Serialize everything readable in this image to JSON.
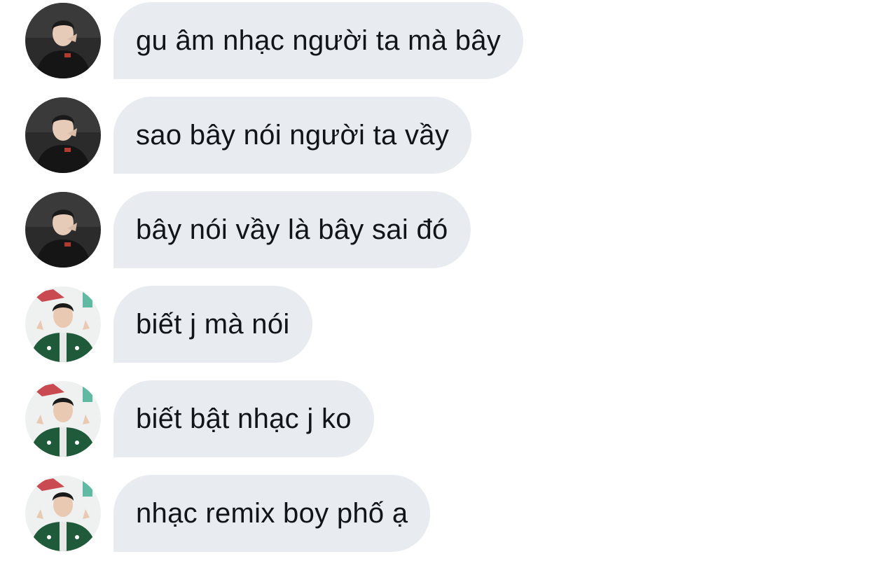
{
  "messages": [
    {
      "text": "gu âm nhạc người ta mà bây",
      "sender_avatar": "avatar-dark-hoodie"
    },
    {
      "text": "sao bây nói người ta vầy",
      "sender_avatar": "avatar-dark-hoodie"
    },
    {
      "text": "bây nói vầy là bây sai đó",
      "sender_avatar": "avatar-dark-hoodie"
    },
    {
      "text": "biết j mà nói",
      "sender_avatar": "avatar-green-jacket"
    },
    {
      "text": "biết bật nhạc j ko",
      "sender_avatar": "avatar-green-jacket"
    },
    {
      "text": "nhạc remix boy phố ạ",
      "sender_avatar": "avatar-green-jacket"
    }
  ],
  "colors": {
    "bubble_bg": "#e8ebef",
    "text": "#111418",
    "background": "#ffffff"
  }
}
